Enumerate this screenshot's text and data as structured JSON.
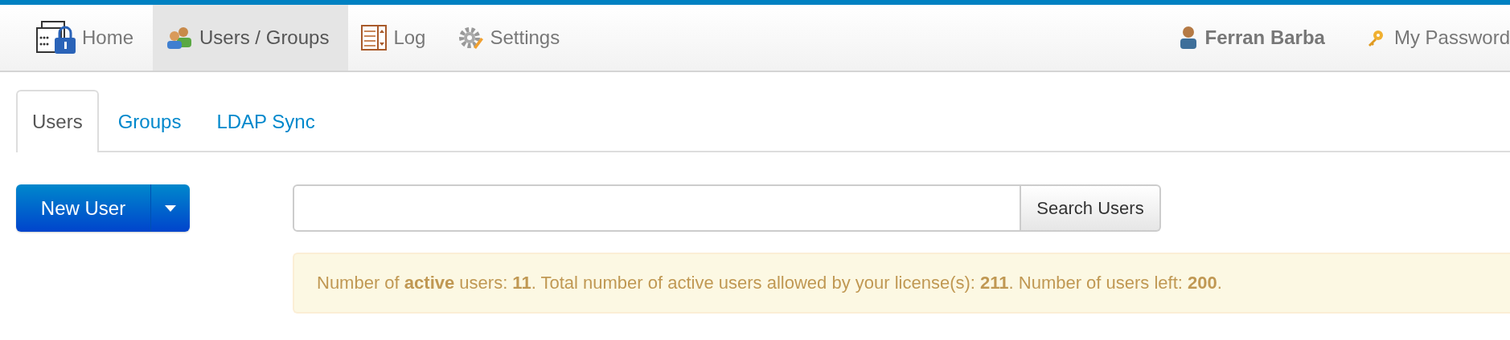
{
  "nav": {
    "items": [
      {
        "label": "Home",
        "kind": "lock",
        "selected": false
      },
      {
        "label": "Users / Groups",
        "kind": "users",
        "selected": true
      },
      {
        "label": "Log",
        "kind": "log",
        "selected": false
      },
      {
        "label": "Settings",
        "kind": "gear",
        "selected": false
      }
    ],
    "user": {
      "label": "Ferran Barba"
    },
    "passwords": {
      "label": "My Password"
    }
  },
  "tabs": [
    {
      "label": "Users",
      "selected": true
    },
    {
      "label": "Groups",
      "selected": false
    },
    {
      "label": "LDAP Sync",
      "selected": false
    }
  ],
  "new_button": {
    "label": "New User"
  },
  "search": {
    "button": "Search Users"
  },
  "alert": {
    "text": "Number of **active** users: **11**. Total number of active users allowed by your license(s): **211**. Number of users left: **200**."
  }
}
